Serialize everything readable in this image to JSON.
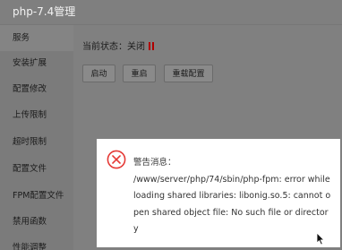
{
  "window": {
    "title": "php-7.4管理"
  },
  "sidebar": {
    "items": [
      {
        "label": "服务",
        "active": true
      },
      {
        "label": "安装扩展"
      },
      {
        "label": "配置修改"
      },
      {
        "label": "上传限制"
      },
      {
        "label": "超时限制"
      },
      {
        "label": "配置文件"
      },
      {
        "label": "FPM配置文件"
      },
      {
        "label": "禁用函数"
      },
      {
        "label": "性能调整"
      }
    ]
  },
  "main": {
    "status_label": "当前状态：关闭",
    "status_icon": "pause-icon",
    "status_color": "#b00000",
    "buttons": {
      "start": "启动",
      "restart": "重启",
      "reload": "重载配置"
    }
  },
  "alert": {
    "icon": "error-circle-x-icon",
    "icon_color": "#e53935",
    "title": "警告消息：",
    "message": "/www/server/php/74/sbin/php-fpm: error while loading shared libraries: libonig.so.5: cannot open shared object file: No such file or directory"
  },
  "cursor": {
    "icon": "mouse-pointer-icon"
  }
}
